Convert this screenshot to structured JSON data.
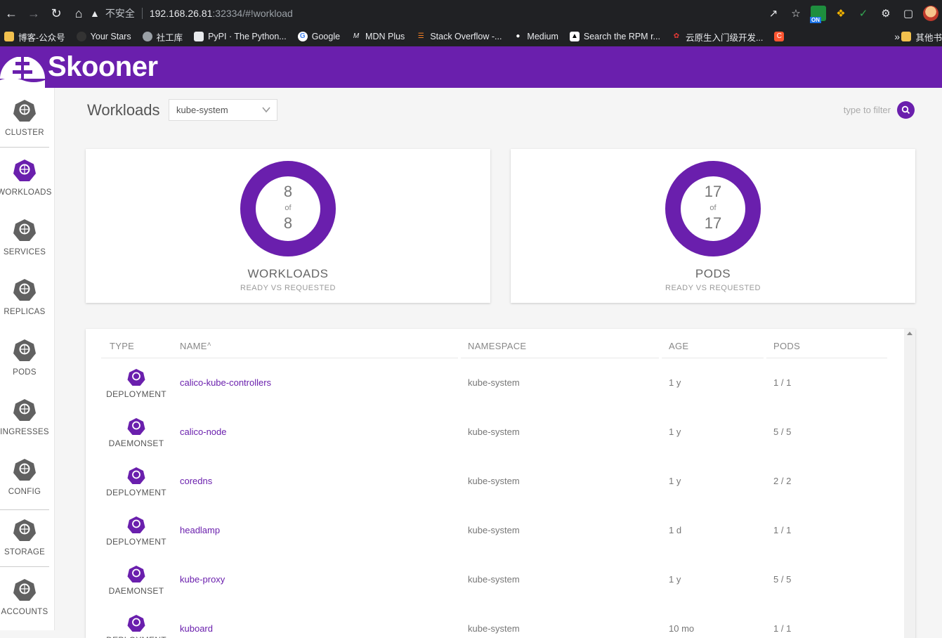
{
  "browser": {
    "insecure_label": "不安全",
    "url_host": "192.168.26.81",
    "url_path": ":32334/#!workload",
    "bookmarks": [
      "博客-公众号",
      "Your Stars",
      "社工库",
      "PyPI · The Python...",
      "Google",
      "MDN Plus",
      "Stack Overflow -...",
      "Medium",
      "Search the RPM r...",
      "云原生入门级开发..."
    ],
    "bookmarks_more": "»",
    "bookmarks_other": "其他书",
    "ext_badge": "ON"
  },
  "app": {
    "title": "Skooner"
  },
  "sidebar": {
    "items": [
      {
        "label": "CLUSTER",
        "icon": "helm-icon",
        "sub": ""
      },
      {
        "label": "WORKLOADS",
        "icon": "deploy-icon",
        "sub": "deploy"
      },
      {
        "label": "SERVICES",
        "icon": "svc-icon",
        "sub": "svc"
      },
      {
        "label": "REPLICAS",
        "icon": "rs-icon",
        "sub": "rs"
      },
      {
        "label": "PODS",
        "icon": "pod-icon",
        "sub": "pod"
      },
      {
        "label": "INGRESSES",
        "icon": "ing-icon",
        "sub": "ing"
      },
      {
        "label": "CONFIG",
        "icon": "cm-icon",
        "sub": "cm"
      },
      {
        "label": "STORAGE",
        "icon": "sc-icon",
        "sub": "sc"
      },
      {
        "label": "ACCOUNTS",
        "icon": "sa-icon",
        "sub": "sa"
      }
    ],
    "active_index": 1
  },
  "main": {
    "title": "Workloads",
    "namespace": "kube-system",
    "filter_placeholder": "type to filter"
  },
  "cards": [
    {
      "ready": "8",
      "of": "of",
      "requested": "8",
      "title": "WORKLOADS",
      "subtitle": "READY VS REQUESTED",
      "fraction": 1.0
    },
    {
      "ready": "17",
      "of": "of",
      "requested": "17",
      "title": "PODS",
      "subtitle": "READY VS REQUESTED",
      "fraction": 1.0
    }
  ],
  "table": {
    "headers": {
      "type": "TYPE",
      "name": "NAME",
      "sort_mark": "˄",
      "namespace": "NAMESPACE",
      "age": "AGE",
      "pods": "PODS"
    },
    "rows": [
      {
        "type": "DEPLOYMENT",
        "icon": "deploy-icon",
        "name": "calico-kube-controllers",
        "namespace": "kube-system",
        "age": "1 y",
        "pods": "1 / 1"
      },
      {
        "type": "DAEMONSET",
        "icon": "daemonset-icon",
        "name": "calico-node",
        "namespace": "kube-system",
        "age": "1 y",
        "pods": "5 / 5"
      },
      {
        "type": "DEPLOYMENT",
        "icon": "deploy-icon",
        "name": "coredns",
        "namespace": "kube-system",
        "age": "1 y",
        "pods": "2 / 2"
      },
      {
        "type": "DEPLOYMENT",
        "icon": "deploy-icon",
        "name": "headlamp",
        "namespace": "kube-system",
        "age": "1 d",
        "pods": "1 / 1"
      },
      {
        "type": "DAEMONSET",
        "icon": "daemonset-icon",
        "name": "kube-proxy",
        "namespace": "kube-system",
        "age": "1 y",
        "pods": "5 / 5"
      },
      {
        "type": "DEPLOYMENT",
        "icon": "deploy-icon",
        "name": "kuboard",
        "namespace": "kube-system",
        "age": "10 mo",
        "pods": "1 / 1"
      }
    ]
  },
  "colors": {
    "brand": "#6a1fad",
    "sidebar_icon": "#616161"
  }
}
